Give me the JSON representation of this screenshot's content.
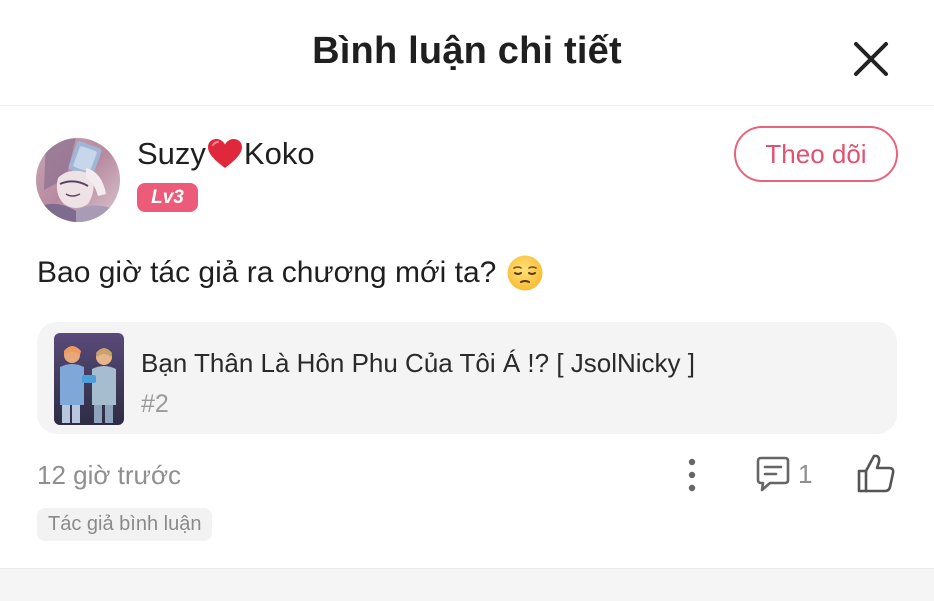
{
  "header": {
    "title": "Bình luận chi tiết",
    "close_icon": "close-icon"
  },
  "comment": {
    "user": {
      "name_part1": "Suzy",
      "name_heart": "❤",
      "name_part2": "Koko",
      "level": "Lv3",
      "follow_label": "Theo dõi"
    },
    "text": "Bao giờ tác giả ra chương mới ta?",
    "emoji": "pensive-face-emoji",
    "story": {
      "title": "Bạn Thân Là Hôn Phu Của Tôi Á !? [ JsolNicky ]",
      "chapter": "#2"
    },
    "time": "12 giờ trước",
    "reply_count": "1",
    "author_tag": "Tác giả bình luận"
  },
  "colors": {
    "accent": "#e8637b",
    "badge": "#ec5b79",
    "muted": "#8f8f8f",
    "card_bg": "#f4f4f4"
  }
}
